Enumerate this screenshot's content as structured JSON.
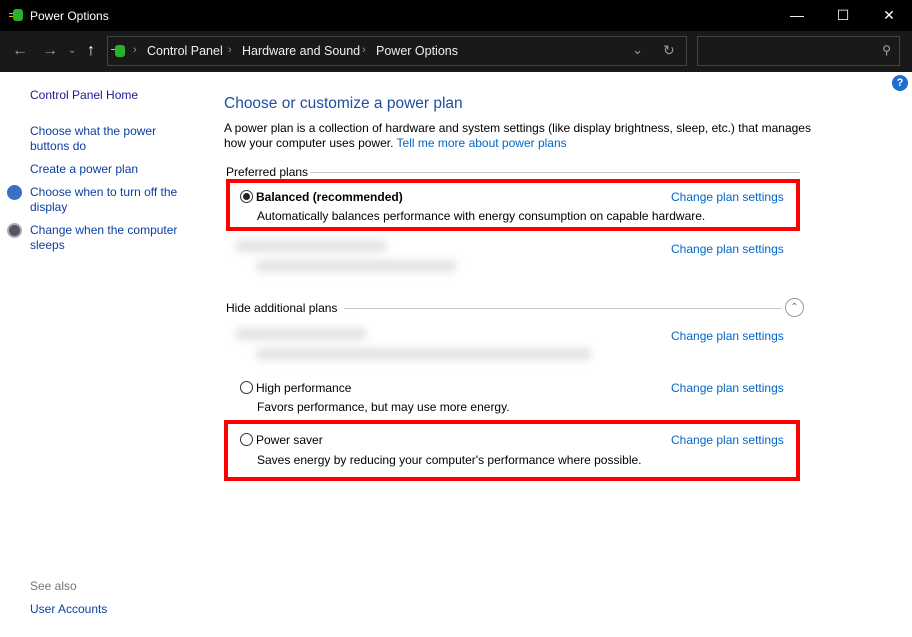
{
  "window": {
    "title": "Power Options"
  },
  "breadcrumb": [
    "Control Panel",
    "Hardware and Sound",
    "Power Options"
  ],
  "search": {
    "placeholder": ""
  },
  "sidebar": {
    "items": [
      "Control Panel Home",
      "Choose what the power buttons do",
      "Create a power plan",
      "Choose when to turn off the display",
      "Change when the computer sleeps"
    ],
    "see_also": "See also",
    "see_also_items": [
      "User Accounts"
    ]
  },
  "main": {
    "title": "Choose or customize a power plan",
    "intro": "A power plan is a collection of hardware and system settings (like display brightness, sleep, etc.) that manages how your computer uses power.",
    "learn_more": "Tell me more about power plans",
    "preferred_label": "Preferred plans",
    "additional_label": "Hide additional plans",
    "change_label": "Change plan settings",
    "plans": [
      {
        "name": "Balanced (recommended)",
        "desc": "Automatically balances performance with energy consumption on capable hardware.",
        "selected": true
      },
      {
        "name": "High performance",
        "desc": "Favors performance, but may use more energy.",
        "selected": false
      },
      {
        "name": "Power saver",
        "desc": "Saves energy by reducing your computer's performance where possible.",
        "selected": false
      }
    ]
  },
  "colors": {
    "highlight": "#ff0000",
    "link": "#0066cc"
  }
}
